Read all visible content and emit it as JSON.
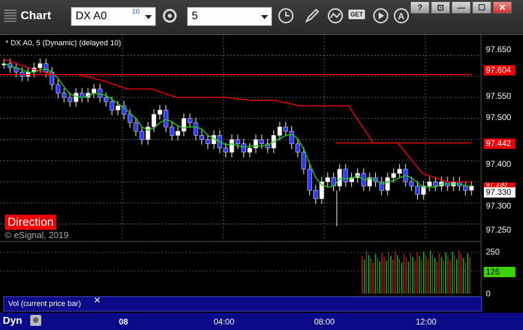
{
  "app": {
    "title": "Chart",
    "symbol": "DX A0",
    "delay_badge": "10",
    "interval": "5"
  },
  "toolbar": {
    "buttons": [
      "gear-icon",
      "clock-icon",
      "pencil-icon",
      "study-icon",
      "get-icon",
      "play-icon",
      "alert-icon"
    ],
    "get_label": "GET",
    "window_buttons": [
      "?",
      "⊡",
      "—",
      "☐",
      "✕"
    ]
  },
  "chart": {
    "legend": "* DX A0, 5 (Dynamic) (delayed 10)",
    "price_labels": [
      "97.650",
      "97.550",
      "97.500",
      "97.450",
      "97.400",
      "97.350",
      "97.300",
      "97.250"
    ],
    "price_tags": {
      "upper_red": "97.604",
      "lower_red": "97.442",
      "red_small": "97.330",
      "last": "97.330"
    },
    "time_labels": [
      "08",
      "04:00",
      "08:00",
      "12:00"
    ],
    "direction_label": "Direction",
    "copyright": "© eSignal, 2019",
    "volume": {
      "labels": [
        "250",
        "126",
        "0"
      ],
      "study_label": "Vol (current price bar)",
      "close_symbol": "✕"
    },
    "bottom": {
      "mode": "Dyn"
    }
  },
  "chart_data": {
    "type": "candlestick",
    "title": "* DX A0, 5 (Dynamic) (delayed 10)",
    "ylim": [
      97.22,
      97.68
    ],
    "series": [
      {
        "name": "Close",
        "values": [
          97.63,
          97.62,
          97.61,
          97.6,
          97.61,
          97.62,
          97.63,
          97.61,
          97.58,
          97.56,
          97.55,
          97.54,
          97.56,
          97.55,
          97.56,
          97.57,
          97.55,
          97.54,
          97.52,
          97.53,
          97.51,
          97.49,
          97.47,
          97.45,
          97.48,
          97.51,
          97.52,
          97.48,
          97.46,
          97.47,
          97.5,
          97.49,
          97.46,
          97.45,
          97.44,
          97.46,
          97.43,
          97.42,
          97.45,
          97.44,
          97.42,
          97.43,
          97.45,
          97.44,
          97.43,
          97.46,
          97.48,
          97.47,
          97.44,
          97.42,
          97.38,
          97.33,
          97.31,
          97.35,
          97.36,
          97.34,
          97.38,
          97.35,
          97.36,
          97.37,
          97.34,
          97.36,
          97.35,
          97.33,
          97.36,
          97.37,
          97.38,
          97.35,
          97.34,
          97.32,
          97.34,
          97.35,
          97.34,
          97.35,
          97.34,
          97.35,
          97.34,
          97.33,
          97.34
        ]
      },
      {
        "name": "Direction (red)",
        "values": [
          97.64,
          97.62,
          97.604,
          97.604,
          97.59,
          97.57,
          97.57,
          97.55,
          97.55,
          97.55,
          97.543,
          97.543,
          97.53,
          97.53,
          97.53,
          97.442,
          97.442,
          97.37,
          97.35,
          97.35
        ]
      }
    ],
    "volume": {
      "ylim": [
        0,
        250
      ],
      "last": 126
    }
  }
}
